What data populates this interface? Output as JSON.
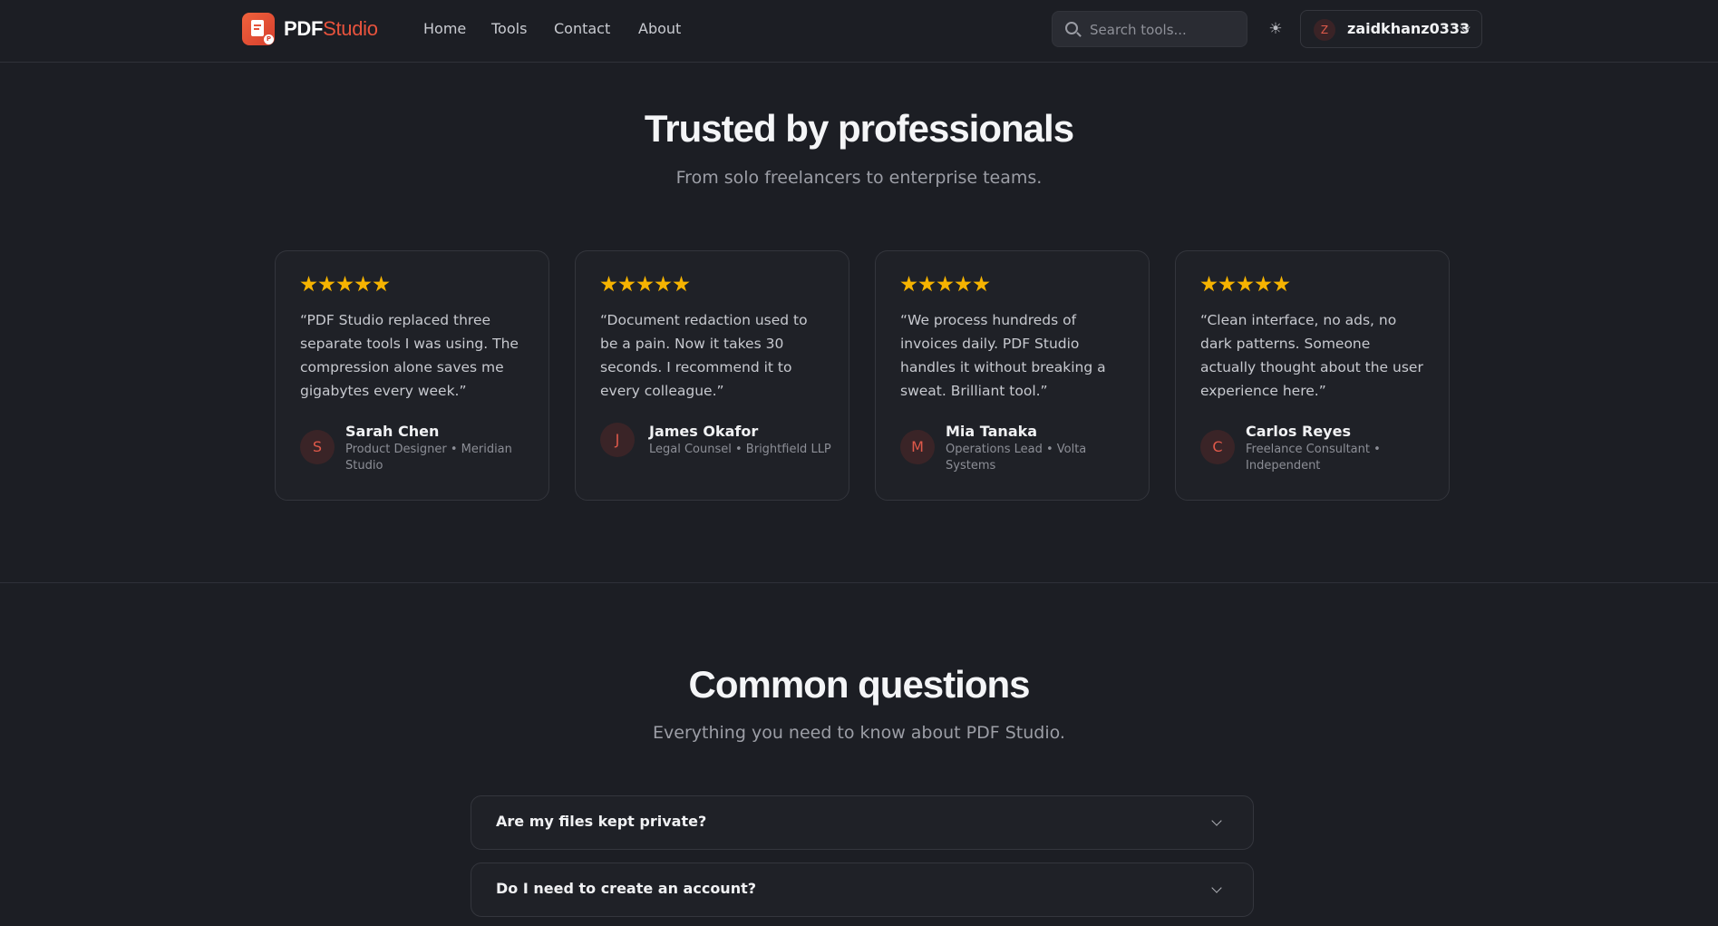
{
  "header": {
    "logo_badge": "P",
    "brand_primary": "PDF",
    "brand_accent": "Studio",
    "nav": [
      "Home",
      "Tools",
      "Contact",
      "About"
    ],
    "search_placeholder": "Search tools...",
    "theme_icon": "sun-icon",
    "user": {
      "initial": "Z",
      "name": "zaidkhanz0333"
    }
  },
  "testimonials": {
    "title": "Trusted by professionals",
    "subtitle": "From solo freelancers to enterprise teams.",
    "rating": 5,
    "items": [
      {
        "quote": "“PDF Studio replaced three separate tools I was using. The compression alone saves me gigabytes every week.”",
        "initial": "S",
        "name": "Sarah Chen",
        "role": "Product Designer • Meridian Studio"
      },
      {
        "quote": "“Document redaction used to be a pain. Now it takes 30 seconds. I recommend it to every colleague.”",
        "initial": "J",
        "name": "James Okafor",
        "role": "Legal Counsel • Brightfield LLP"
      },
      {
        "quote": "“We process hundreds of invoices daily. PDF Studio handles it without breaking a sweat. Brilliant tool.”",
        "initial": "M",
        "name": "Mia Tanaka",
        "role": "Operations Lead • Volta Systems"
      },
      {
        "quote": "“Clean interface, no ads, no dark patterns. Someone actually thought about the user experience here.”",
        "initial": "C",
        "name": "Carlos Reyes",
        "role": "Freelance Consultant • Independent"
      }
    ]
  },
  "faq": {
    "title": "Common questions",
    "subtitle": "Everything you need to know about PDF Studio.",
    "items": [
      {
        "question": "Are my files kept private?"
      },
      {
        "question": "Do I need to create an account?"
      }
    ]
  },
  "colors": {
    "background": "#1c1e24",
    "brand_accent": "#e8533d",
    "star": "#f5b301"
  }
}
